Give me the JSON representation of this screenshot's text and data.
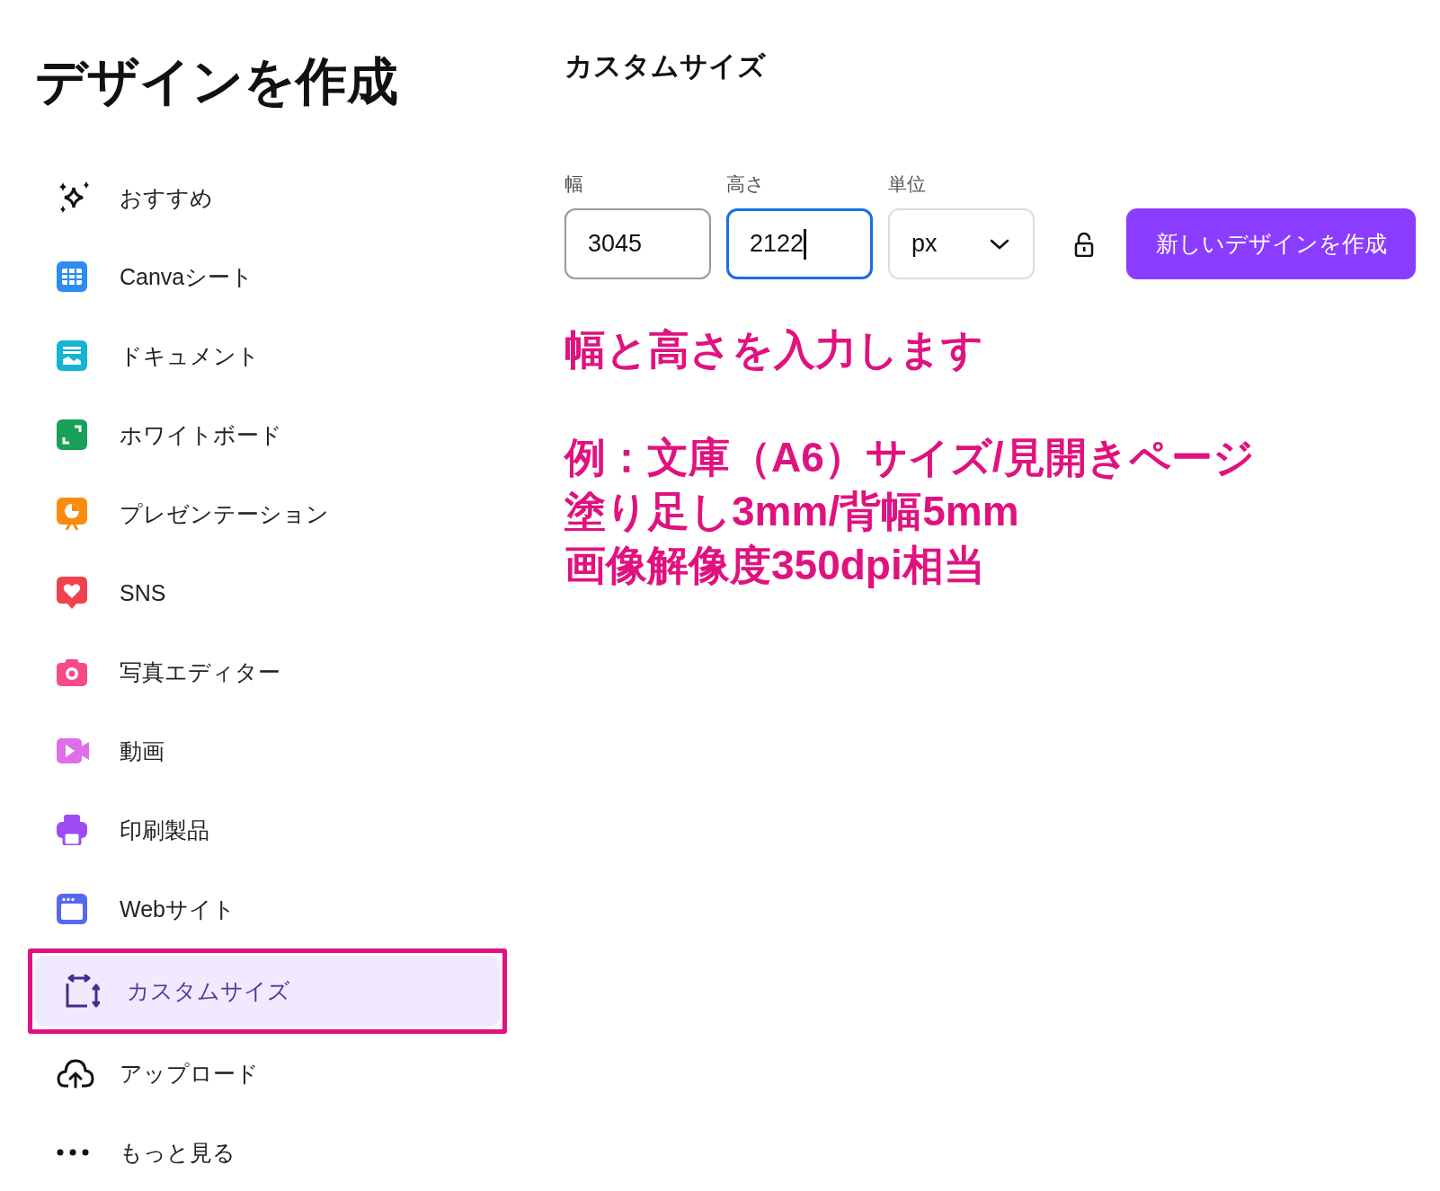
{
  "title": "デザインを作成",
  "sidebar": {
    "items": [
      {
        "label": "おすすめ",
        "selected": false
      },
      {
        "label": "Canvaシート",
        "selected": false
      },
      {
        "label": "ドキュメント",
        "selected": false
      },
      {
        "label": "ホワイトボード",
        "selected": false
      },
      {
        "label": "プレゼンテーション",
        "selected": false
      },
      {
        "label": "SNS",
        "selected": false
      },
      {
        "label": "写真エディター",
        "selected": false
      },
      {
        "label": "動画",
        "selected": false
      },
      {
        "label": "印刷製品",
        "selected": false
      },
      {
        "label": "Webサイト",
        "selected": false
      },
      {
        "label": "カスタムサイズ",
        "selected": true
      },
      {
        "label": "アップロード",
        "selected": false
      },
      {
        "label": "もっと見る",
        "selected": false
      }
    ]
  },
  "custom_size": {
    "heading": "カスタムサイズ",
    "width": {
      "label": "幅",
      "value": "3045",
      "focused": false
    },
    "height": {
      "label": "高さ",
      "value": "2122",
      "focused": true
    },
    "unit": {
      "label": "単位",
      "value": "px"
    },
    "locked": false,
    "create_button": "新しいデザインを作成"
  },
  "annotation": {
    "instruction": "幅と高さを入力します",
    "lines": [
      "例：文庫（A6）サイズ/見開きページ",
      "塗り足し3mm/背幅5mm",
      "画像解像度350dpi相当"
    ]
  }
}
